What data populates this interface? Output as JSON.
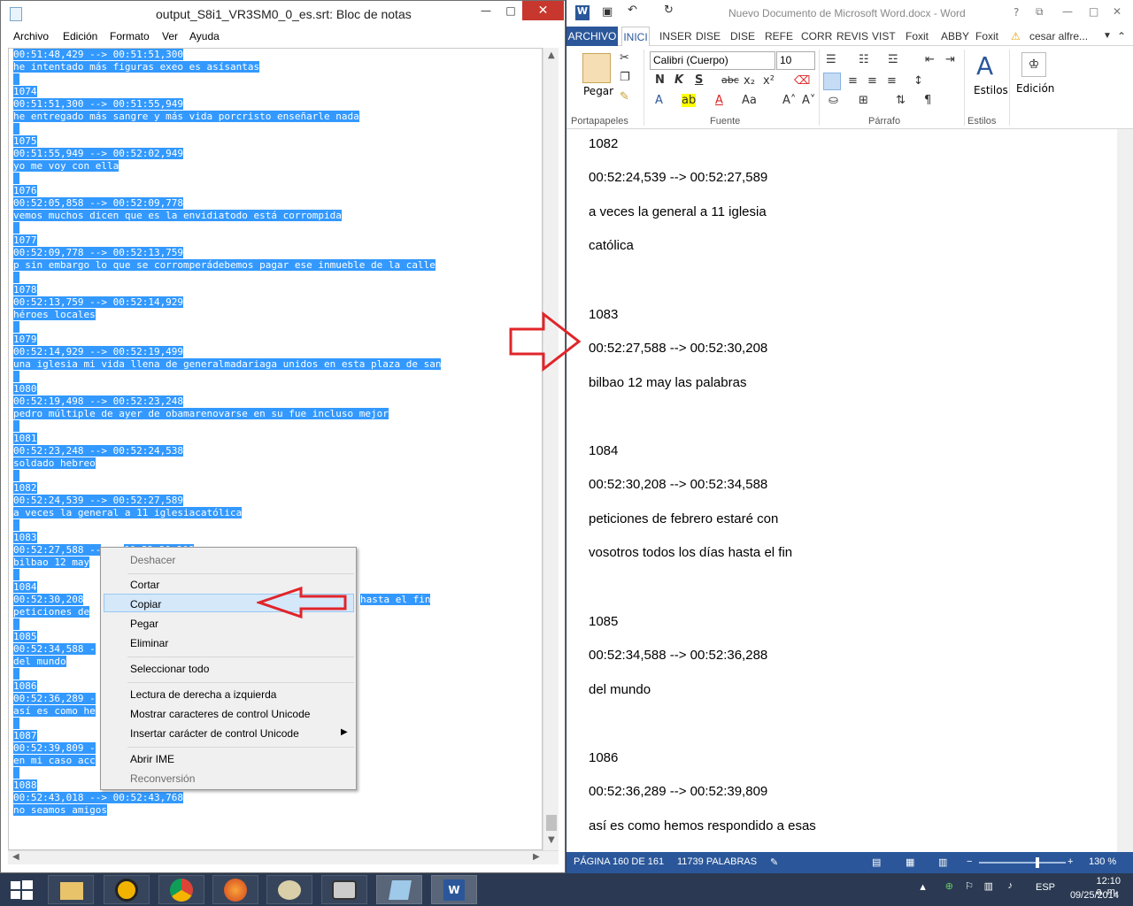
{
  "notepad": {
    "title": "output_S8i1_VR3SM0_0_es.srt: Bloc de notas",
    "menu": [
      "Archivo",
      "Edición",
      "Formato",
      "Ver",
      "Ayuda"
    ],
    "lines": [
      "00:51:48,429 --> 00:51:51,300",
      "he intentado más figuras exeo es asísantas",
      "",
      "1074",
      "00:51:51,300 --> 00:51:55,949",
      "he entregado más sangre y más vida porcristo enseñarle nada",
      "",
      "1075",
      "00:51:55,949 --> 00:52:02,949",
      "yo me voy con ella",
      "",
      "1076",
      "00:52:05,858 --> 00:52:09,778",
      "vemos muchos dicen que es la envidiatodo está corrompida",
      "",
      "1077",
      "00:52:09,778 --> 00:52:13,759",
      "p sin embargo lo que se corromperádebemos pagar ese inmueble de la calle",
      "",
      "1078",
      "00:52:13,759 --> 00:52:14,929",
      "héroes locales",
      "",
      "1079",
      "00:52:14,929 --> 00:52:19,499",
      "una iglesia mi vida llena de generalmadariaga unidos en esta plaza de san",
      "",
      "1080",
      "00:52:19,498 --> 00:52:23,248",
      "pedro múltiple de ayer de obamarenovarse en su fue incluso mejor",
      "",
      "1081",
      "00:52:23,248 --> 00:52:24,538",
      "soldado hebreo",
      "",
      "1082",
      "00:52:24,539 --> 00:52:27,589",
      "a veces la general a 11 iglesiacatólica",
      "",
      "1083",
      "00:52:27,588 --",
      "bilbao 12 may",
      "",
      "1084",
      "00:52:30,208",
      "peticiones de",
      "",
      "1085",
      "00:52:34,588 -",
      "del mundo",
      "",
      "1086",
      "00:52:36,289 -",
      "así es como he",
      "",
      "1087",
      "00:52:39,809 -",
      "en mi caso acc",
      "",
      "1088",
      "00:52:43,018 --> 00:52:43,768",
      "no seamos amigos"
    ],
    "line_tail_1084": "hasta el fin",
    "line_tail_1083": "00:52:30,208"
  },
  "context_menu": {
    "items": [
      {
        "label": "Deshacer",
        "enabled": false
      },
      {
        "label": "Cortar",
        "enabled": true
      },
      {
        "label": "Copiar",
        "enabled": true,
        "highlighted": true
      },
      {
        "label": "Pegar",
        "enabled": true
      },
      {
        "label": "Eliminar",
        "enabled": true
      },
      {
        "label": "Seleccionar todo",
        "enabled": true
      },
      {
        "label": "Lectura de derecha a izquierda",
        "enabled": true
      },
      {
        "label": "Mostrar caracteres de control Unicode",
        "enabled": true
      },
      {
        "label": "Insertar carácter de control Unicode",
        "enabled": true,
        "submenu": true
      },
      {
        "label": "Abrir IME",
        "enabled": true
      },
      {
        "label": "Reconversión",
        "enabled": false
      }
    ]
  },
  "word": {
    "title": "Nuevo Documento de Microsoft Word.docx - Word",
    "help": "?",
    "tabs": [
      "ARCHIVO",
      "INICI",
      "INSER",
      "DISE",
      "DISE",
      "REFE",
      "CORR",
      "REVIS",
      "VIST",
      "Foxit",
      "ABBY",
      "Foxit"
    ],
    "user": "cesar alfre...",
    "font_name": "Calibri (Cuerpo)",
    "font_size": "10",
    "groups": [
      "Portapapeles",
      "Fuente",
      "Párrafo",
      "Estilos"
    ],
    "buttons": {
      "paste": "Pegar",
      "styles": "Estilos",
      "editing": "Edición"
    },
    "format_labels": [
      "N",
      "K",
      "S",
      "abc",
      "x₂",
      "x²"
    ],
    "paragraphs": [
      "1082",
      "00:52:24,539 --> 00:52:27,589",
      "a veces la general a 11 iglesia",
      "católica",
      "1083",
      "00:52:27,588 --> 00:52:30,208",
      "bilbao 12 may las palabras",
      "1084",
      "00:52:30,208 --> 00:52:34,588",
      "peticiones de febrero estaré con",
      "vosotros todos los días hasta el fin",
      "1085",
      "00:52:34,588 --> 00:52:36,288",
      "del mundo",
      "1086",
      "00:52:36,289 --> 00:52:39,809",
      "así es como hemos respondido a esas"
    ],
    "status": {
      "page": "PÁGINA 160 DE 161",
      "words": "11739 PALABRAS",
      "zoom": "130 %",
      "zoom_level": 0.65
    }
  },
  "taskbar": {
    "language": "ESP",
    "time": "12:10 a. m.",
    "date": "09/25/2014"
  },
  "colors": {
    "selection": "#3399ff",
    "word_blue": "#2b579a",
    "arrow_red": "#e0252a",
    "close_red": "#c7372d"
  }
}
